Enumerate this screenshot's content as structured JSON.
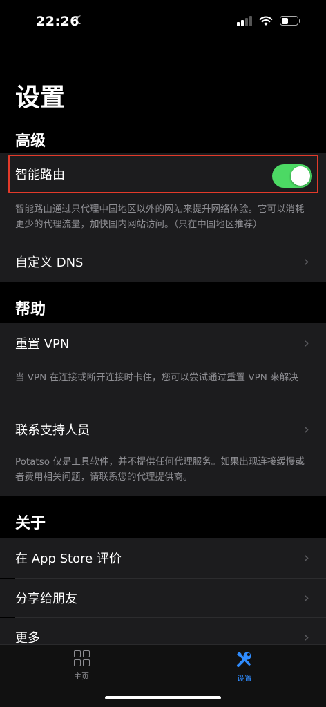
{
  "status_bar": {
    "time": "22:26"
  },
  "page": {
    "title": "设置"
  },
  "sections": {
    "advanced": {
      "header": "高级",
      "smart_routing_label": "智能路由",
      "smart_routing_enabled": true,
      "smart_routing_footnote": "智能路由通过只代理中国地区以外的网站来提升网络体验。它可以消耗更少的代理流量，加快国内网站访问。（只在中国地区推荐）",
      "custom_dns_label": "自定义 DNS"
    },
    "help": {
      "header": "帮助",
      "reset_vpn_label": "重置 VPN",
      "reset_vpn_footnote": "当 VPN 在连接或断开连接时卡住，您可以尝试通过重置 VPN 来解决",
      "contact_support_label": "联系支持人员",
      "contact_support_footnote": "Potatso 仅是工具软件，并不提供任何代理服务。如果出现连接缓慢或者费用相关问题，请联系您的代理提供商。"
    },
    "about": {
      "header": "关于",
      "rate_label": "在 App Store 评价",
      "share_label": "分享给朋友",
      "more_label": "更多"
    }
  },
  "tabbar": {
    "home_label": "主页",
    "settings_label": "设置",
    "active_color": "#2f8cff",
    "inactive_color": "#8e8e93"
  },
  "colors": {
    "toggle_on": "#4cd964",
    "highlight": "#e23a2a"
  }
}
